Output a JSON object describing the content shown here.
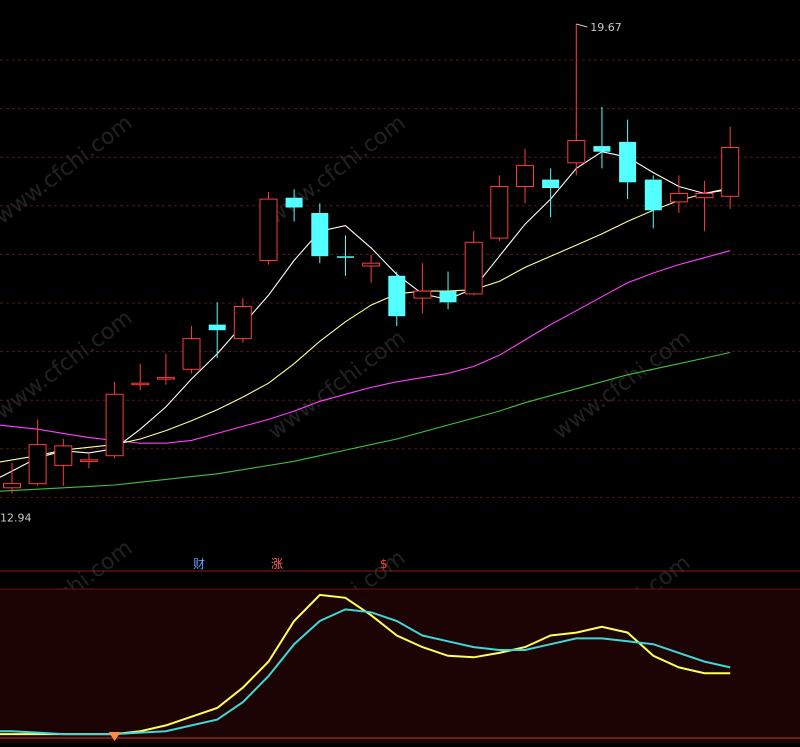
{
  "chart_data": [
    {
      "type": "candlestick",
      "title": "",
      "price_high_label": "19.67",
      "price_low_label": "12.94",
      "event_markers": [
        "财",
        "涨",
        "$"
      ],
      "watermark": "www.cfchi.com",
      "ylim": [
        12.3,
        19.9
      ],
      "colors": {
        "up": "#ff3b3b",
        "down": "#54ffff",
        "ma_fast": "#ffffff",
        "ma_mid": "#ffff99",
        "ma_slow": "#ff40ff",
        "ma_long": "#40c040",
        "grid": "#5a1414",
        "label": "#c8c8c8"
      },
      "candles": [
        {
          "o": 13.02,
          "h": 13.38,
          "l": 12.94,
          "c": 13.08
        },
        {
          "o": 13.08,
          "h": 14.0,
          "l": 13.05,
          "c": 13.64
        },
        {
          "o": 13.34,
          "h": 13.72,
          "l": 13.05,
          "c": 13.62
        },
        {
          "o": 13.42,
          "h": 13.52,
          "l": 13.3,
          "c": 13.42
        },
        {
          "o": 13.48,
          "h": 14.54,
          "l": 13.44,
          "c": 14.36
        },
        {
          "o": 14.5,
          "h": 14.8,
          "l": 14.42,
          "c": 14.52
        },
        {
          "o": 14.58,
          "h": 14.94,
          "l": 14.5,
          "c": 14.6
        },
        {
          "o": 14.72,
          "h": 15.34,
          "l": 14.66,
          "c": 15.16
        },
        {
          "o": 15.36,
          "h": 15.68,
          "l": 14.88,
          "c": 15.28
        },
        {
          "o": 15.16,
          "h": 15.74,
          "l": 15.1,
          "c": 15.62
        },
        {
          "o": 16.28,
          "h": 17.26,
          "l": 16.22,
          "c": 17.16
        },
        {
          "o": 17.18,
          "h": 17.3,
          "l": 16.84,
          "c": 17.04
        },
        {
          "o": 16.96,
          "h": 17.1,
          "l": 16.24,
          "c": 16.34
        },
        {
          "o": 16.34,
          "h": 16.64,
          "l": 16.06,
          "c": 16.32
        },
        {
          "o": 16.2,
          "h": 16.36,
          "l": 15.96,
          "c": 16.24
        },
        {
          "o": 16.06,
          "h": 16.12,
          "l": 15.34,
          "c": 15.48
        },
        {
          "o": 15.74,
          "h": 16.24,
          "l": 15.52,
          "c": 15.84
        },
        {
          "o": 15.84,
          "h": 16.12,
          "l": 15.58,
          "c": 15.68
        },
        {
          "o": 15.8,
          "h": 16.7,
          "l": 15.78,
          "c": 16.54
        },
        {
          "o": 16.6,
          "h": 17.5,
          "l": 16.56,
          "c": 17.34
        },
        {
          "o": 17.34,
          "h": 17.88,
          "l": 17.1,
          "c": 17.64
        },
        {
          "o": 17.44,
          "h": 17.6,
          "l": 16.9,
          "c": 17.32
        },
        {
          "o": 17.68,
          "h": 19.67,
          "l": 17.5,
          "c": 18.0
        },
        {
          "o": 17.92,
          "h": 18.48,
          "l": 17.6,
          "c": 17.84
        },
        {
          "o": 17.98,
          "h": 18.3,
          "l": 17.16,
          "c": 17.4
        },
        {
          "o": 17.44,
          "h": 17.5,
          "l": 16.74,
          "c": 17.0
        },
        {
          "o": 17.12,
          "h": 17.5,
          "l": 16.96,
          "c": 17.24
        },
        {
          "o": 17.18,
          "h": 17.42,
          "l": 16.7,
          "c": 17.24
        },
        {
          "o": 17.2,
          "h": 18.2,
          "l": 17.02,
          "c": 17.9
        }
      ],
      "ma_fast": [
        13.26,
        13.45,
        13.55,
        13.52,
        13.58,
        13.86,
        14.18,
        14.58,
        14.94,
        15.36,
        15.78,
        16.28,
        16.7,
        16.78,
        16.46,
        16.08,
        15.8,
        15.72,
        15.88,
        16.34,
        16.8,
        17.16,
        17.6,
        17.84,
        17.76,
        17.54,
        17.34,
        17.24,
        17.3
      ],
      "ma_mid": [
        13.42,
        13.48,
        13.56,
        13.6,
        13.64,
        13.72,
        13.84,
        13.98,
        14.14,
        14.32,
        14.52,
        14.8,
        15.12,
        15.4,
        15.64,
        15.8,
        15.84,
        15.84,
        15.86,
        15.98,
        16.18,
        16.34,
        16.5,
        16.66,
        16.84,
        17.0,
        17.14,
        17.24,
        17.32
      ],
      "ma_slow": [
        13.9,
        13.86,
        13.8,
        13.74,
        13.7,
        13.66,
        13.66,
        13.7,
        13.8,
        13.9,
        14.0,
        14.12,
        14.26,
        14.36,
        14.46,
        14.54,
        14.6,
        14.66,
        14.76,
        14.92,
        15.14,
        15.36,
        15.56,
        15.76,
        15.96,
        16.1,
        16.22,
        16.32,
        16.42
      ],
      "ma_long": [
        12.98,
        13.0,
        13.02,
        13.04,
        13.06,
        13.1,
        13.14,
        13.18,
        13.22,
        13.28,
        13.34,
        13.4,
        13.48,
        13.56,
        13.64,
        13.72,
        13.82,
        13.92,
        14.02,
        14.12,
        14.24,
        14.34,
        14.44,
        14.54,
        14.64,
        14.72,
        14.8,
        14.88,
        14.96
      ]
    },
    {
      "type": "line",
      "title": "",
      "ylim": [
        0,
        100
      ],
      "series": [
        {
          "color": "#ffff55",
          "values": [
            2,
            2,
            2,
            2,
            2,
            4,
            8,
            14,
            20,
            34,
            52,
            80,
            98,
            96,
            84,
            70,
            62,
            56,
            55,
            58,
            62,
            70,
            72,
            76,
            72,
            56,
            48,
            44,
            44
          ]
        },
        {
          "color": "#3fd7d7",
          "values": [
            4,
            3,
            2,
            2,
            2,
            3,
            4,
            8,
            12,
            24,
            42,
            64,
            80,
            88,
            86,
            80,
            70,
            66,
            62,
            60,
            60,
            64,
            68,
            68,
            66,
            64,
            58,
            52,
            48
          ]
        }
      ],
      "signal_marker_index": 4
    }
  ]
}
